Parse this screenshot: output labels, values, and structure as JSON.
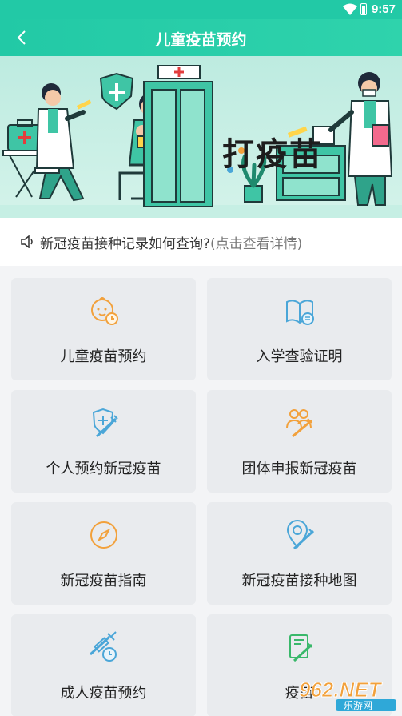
{
  "status_bar": {
    "time": "9:57"
  },
  "app_bar": {
    "title": "儿童疫苗预约"
  },
  "banner": {
    "sign_text": "打疫苗"
  },
  "notice": {
    "text": "新冠疫苗接种记录如何查询?",
    "hint": "(点击查看详情)"
  },
  "tiles": [
    {
      "label": "儿童疫苗预约",
      "icon": "baby-clock-icon"
    },
    {
      "label": "入学查验证明",
      "icon": "open-book-icon"
    },
    {
      "label": "个人预约新冠疫苗",
      "icon": "shield-syringe-icon"
    },
    {
      "label": "团体申报新冠疫苗",
      "icon": "group-syringe-icon"
    },
    {
      "label": "新冠疫苗指南",
      "icon": "compass-icon"
    },
    {
      "label": "新冠疫苗接种地图",
      "icon": "map-pin-syringe-icon"
    },
    {
      "label": "成人疫苗预约",
      "icon": "syringe-clock-icon"
    },
    {
      "label": "疫苗",
      "icon": "certificate-syringe-icon"
    }
  ],
  "watermark": {
    "text": "962.NET",
    "subtext": "乐游网"
  },
  "colors": {
    "accent": "#22c9a6",
    "icon_orange": "#f2a13c",
    "icon_blue": "#4aa6d8",
    "icon_green": "#39b86a"
  }
}
